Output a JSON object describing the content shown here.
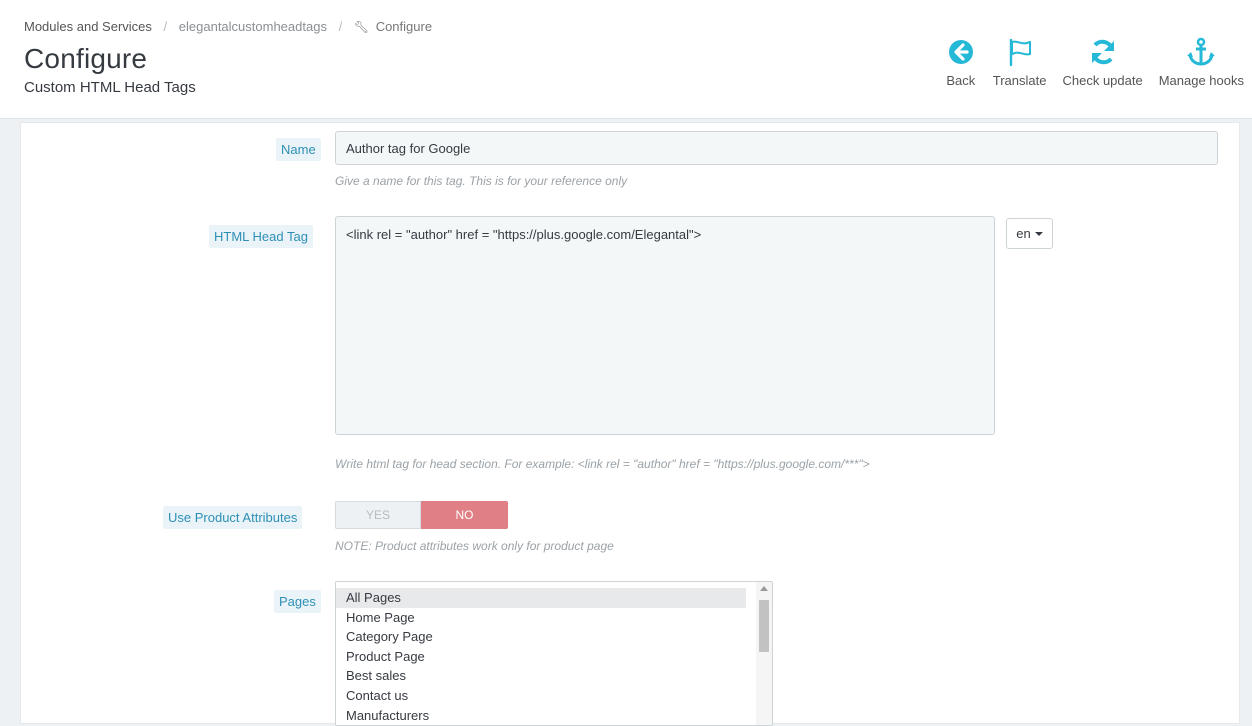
{
  "breadcrumb": {
    "modules": "Modules and Services",
    "module": "elegantalcustomheadtags",
    "current": "Configure",
    "separator": "/"
  },
  "page": {
    "title": "Configure",
    "subtitle": "Custom HTML Head Tags"
  },
  "toolbar": [
    {
      "label": "Back",
      "icon": "back-arrow-circle-icon"
    },
    {
      "label": "Translate",
      "icon": "flag-icon"
    },
    {
      "label": "Check update",
      "icon": "refresh-icon"
    },
    {
      "label": "Manage hooks",
      "icon": "anchor-icon"
    }
  ],
  "form": {
    "name": {
      "label": "Name",
      "value": "Author tag for Google",
      "help": "Give a name for this tag. This is for your reference only"
    },
    "html_head_tag": {
      "label": "HTML Head Tag",
      "value": "<link rel = \"author\" href = \"https://plus.google.com/Elegantal\">",
      "language": "en",
      "help": "Write html tag for head section. For example: <link rel = \"author\" href = \"https://plus.google.com/***\">"
    },
    "use_product_attributes": {
      "label": "Use Product Attributes",
      "yes": "YES",
      "no": "NO",
      "selected": "NO",
      "note": "NOTE: Product attributes work only for product page"
    },
    "pages": {
      "label": "Pages",
      "options": [
        "All Pages",
        "Home Page",
        "Category Page",
        "Product Page",
        "Best sales",
        "Contact us",
        "Manufacturers"
      ],
      "selected": "All Pages"
    }
  },
  "colors": {
    "accent": "#25b9d7",
    "label_text": "#2e8fb5",
    "no_active": "#e07f86",
    "background": "#eef1f3"
  }
}
